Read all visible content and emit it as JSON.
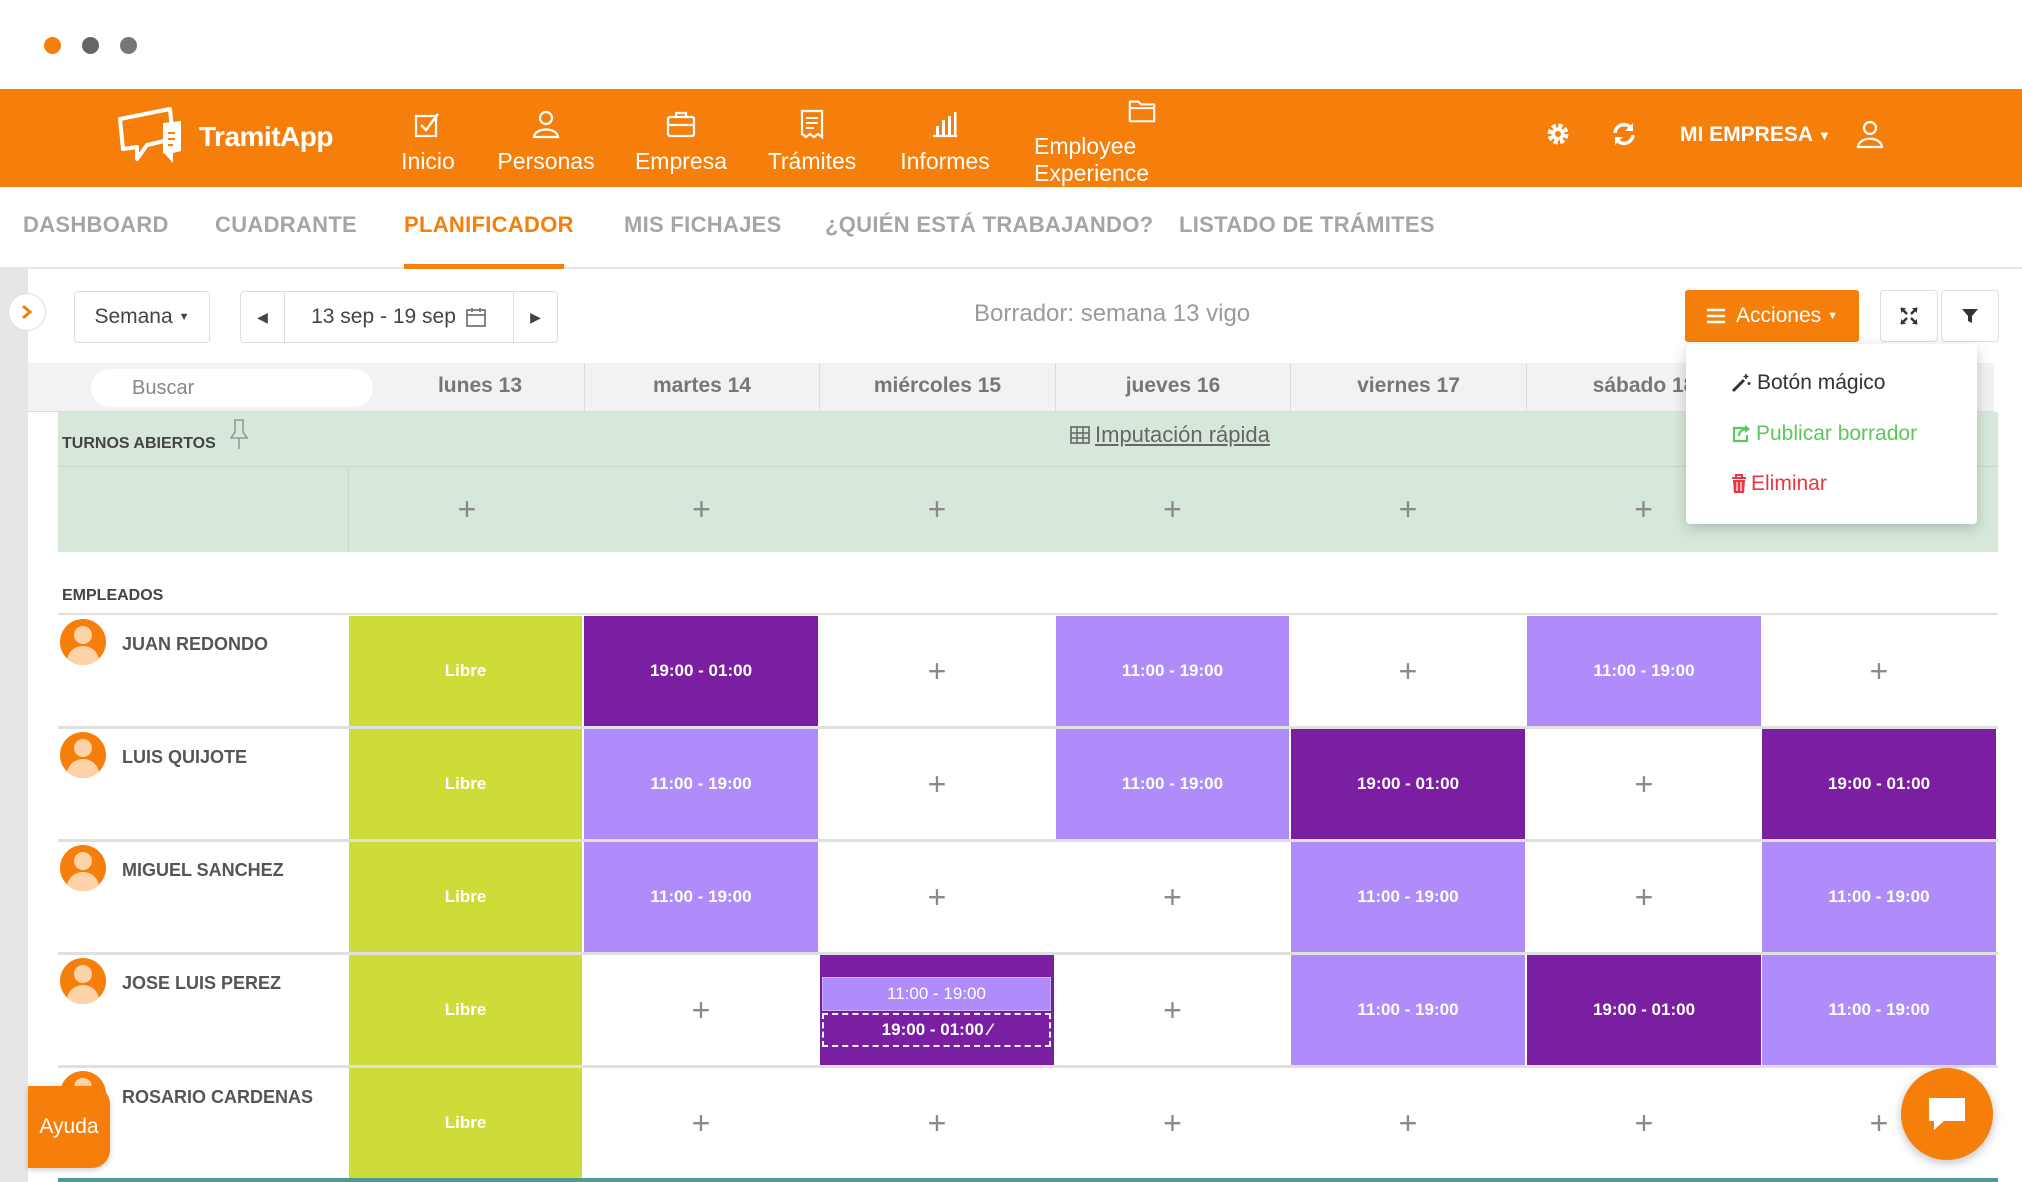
{
  "window": {
    "dot_colors": [
      "#f57f0a",
      "#666666",
      "#777777"
    ]
  },
  "brand": {
    "name": "TramitApp",
    "accent": "#f57f0a"
  },
  "nav": {
    "items": [
      {
        "label": "Inicio",
        "icon": "checkbox-icon"
      },
      {
        "label": "Personas",
        "icon": "person-icon"
      },
      {
        "label": "Empresa",
        "icon": "briefcase-icon"
      },
      {
        "label": "Trámites",
        "icon": "receipt-icon"
      },
      {
        "label": "Informes",
        "icon": "bar-chart-icon"
      },
      {
        "label": "Employee Experience",
        "icon": "folder-icon"
      }
    ],
    "company": "MI EMPRESA"
  },
  "subnav": {
    "tabs": [
      "DASHBOARD",
      "CUADRANTE",
      "PLANIFICADOR",
      "MIS FICHAJES",
      "¿QUIÉN ESTÁ TRABAJANDO?",
      "LISTADO DE TRÁMITES"
    ],
    "active": "PLANIFICADOR"
  },
  "toolbar": {
    "view_select": "Semana",
    "date_range": "13 sep - 19 sep",
    "draft_title": "Borrador: semana 13 vigo",
    "actions_label": "Acciones"
  },
  "actions_menu": {
    "items": [
      {
        "label": "Botón mágico",
        "color": "#333333"
      },
      {
        "label": "Publicar borrador",
        "color": "#5cc85c"
      },
      {
        "label": "Eliminar",
        "color": "#e8383d"
      }
    ]
  },
  "grid": {
    "search_placeholder": "Buscar",
    "days": [
      "lunes 13",
      "martes 14",
      "miércoles 15",
      "jueves 16",
      "viernes 17",
      "sábado 18"
    ],
    "open_shifts_label": "TURNOS ABIERTOS",
    "quick_entry": "Imputación rápida",
    "employees_label": "EMPLEADOS",
    "employees": [
      {
        "name": "JUAN REDONDO",
        "shifts": [
          "Libre",
          "19:00 - 01:00",
          "",
          "11:00 - 19:00",
          "",
          "11:00 - 19:00",
          ""
        ]
      },
      {
        "name": "LUIS QUIJOTE",
        "shifts": [
          "Libre",
          "11:00 - 19:00",
          "",
          "11:00 - 19:00",
          "19:00 - 01:00",
          "",
          "19:00 - 01:00"
        ]
      },
      {
        "name": "MIGUEL SANCHEZ",
        "shifts": [
          "Libre",
          "11:00 - 19:00",
          "",
          "",
          "11:00 - 19:00",
          "",
          "11:00 - 19:00"
        ]
      },
      {
        "name": "JOSE LUIS PEREZ",
        "shifts": [
          "Libre",
          "",
          "11:00 - 19:00",
          "",
          "11:00 - 19:00",
          "19:00 - 01:00",
          "11:00 - 19:00"
        ],
        "extra_shift": "19:00 - 01:00"
      },
      {
        "name": "ROSARIO CARDENAS",
        "shifts": [
          "Libre",
          "",
          "",
          "",
          "",
          "",
          ""
        ]
      }
    ],
    "colors": {
      "free": "#cddc39",
      "day": "#b08cfa",
      "night": "#7b1fa2"
    }
  },
  "help_label": "Ayuda"
}
